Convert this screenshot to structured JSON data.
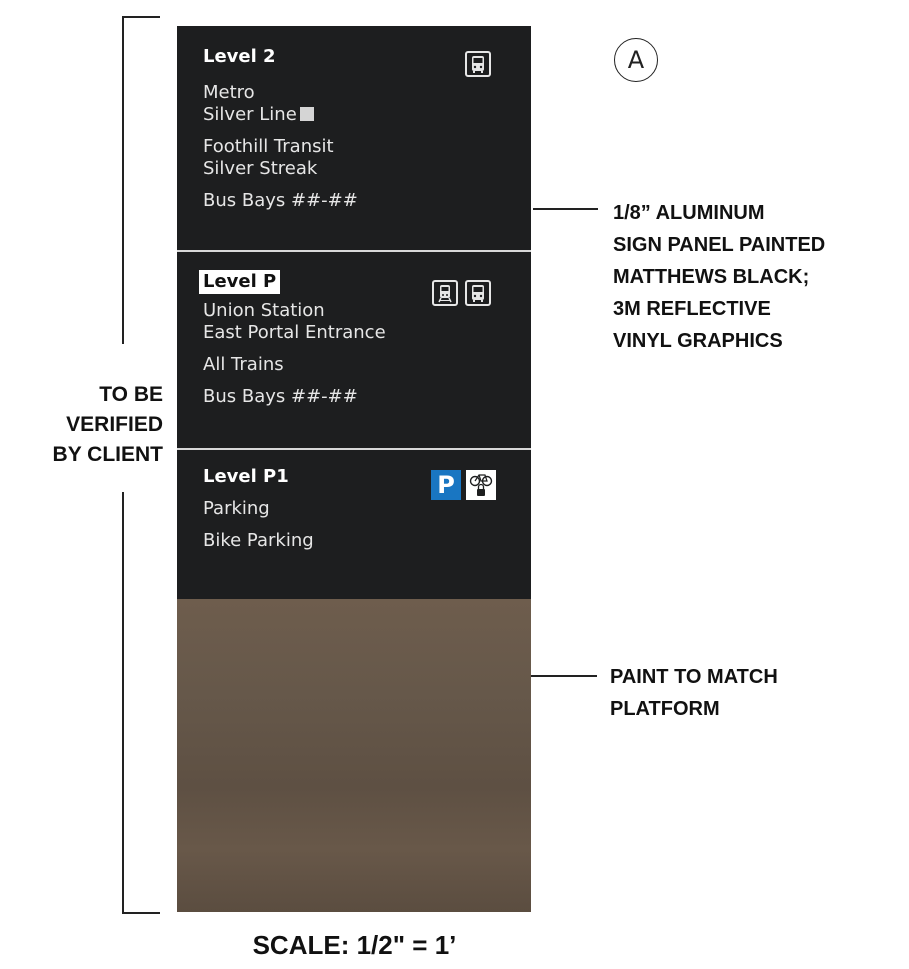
{
  "marker": "A",
  "bracket_label": [
    "TO BE",
    "VERIFIED",
    "BY CLIENT"
  ],
  "sign": {
    "panel_color": "#1d1e1f",
    "base_color": "#66584a",
    "sections": [
      {
        "level": "Level 2",
        "level_style": "plain",
        "lines": [
          "Metro",
          "Silver Line",
          "Foothill Transit",
          "Silver Streak",
          "Bus Bays ##-##"
        ],
        "icons": [
          "bus-icon"
        ]
      },
      {
        "level": "Level P",
        "level_style": "inverted",
        "lines": [
          "Union Station",
          "East Portal Entrance",
          "All Trains",
          "Bus Bays ##-##"
        ],
        "icons": [
          "train-icon",
          "bus-icon"
        ]
      },
      {
        "level": "Level P1",
        "level_style": "plain",
        "lines": [
          "Parking",
          "Bike Parking"
        ],
        "icons": [
          "parking-icon",
          "bike-lock-icon"
        ],
        "parking_glyph": "P"
      }
    ]
  },
  "callouts": {
    "panel": [
      "1/8” ALUMINUM",
      "SIGN PANEL PAINTED",
      "MATTHEWS BLACK;",
      "3M REFLECTIVE",
      "VINYL GRAPHICS"
    ],
    "base": [
      "PAINT TO MATCH",
      "PLATFORM"
    ]
  },
  "scale": "SCALE: 1/2\" = 1’",
  "colors": {
    "parking_blue": "#1976c2"
  }
}
